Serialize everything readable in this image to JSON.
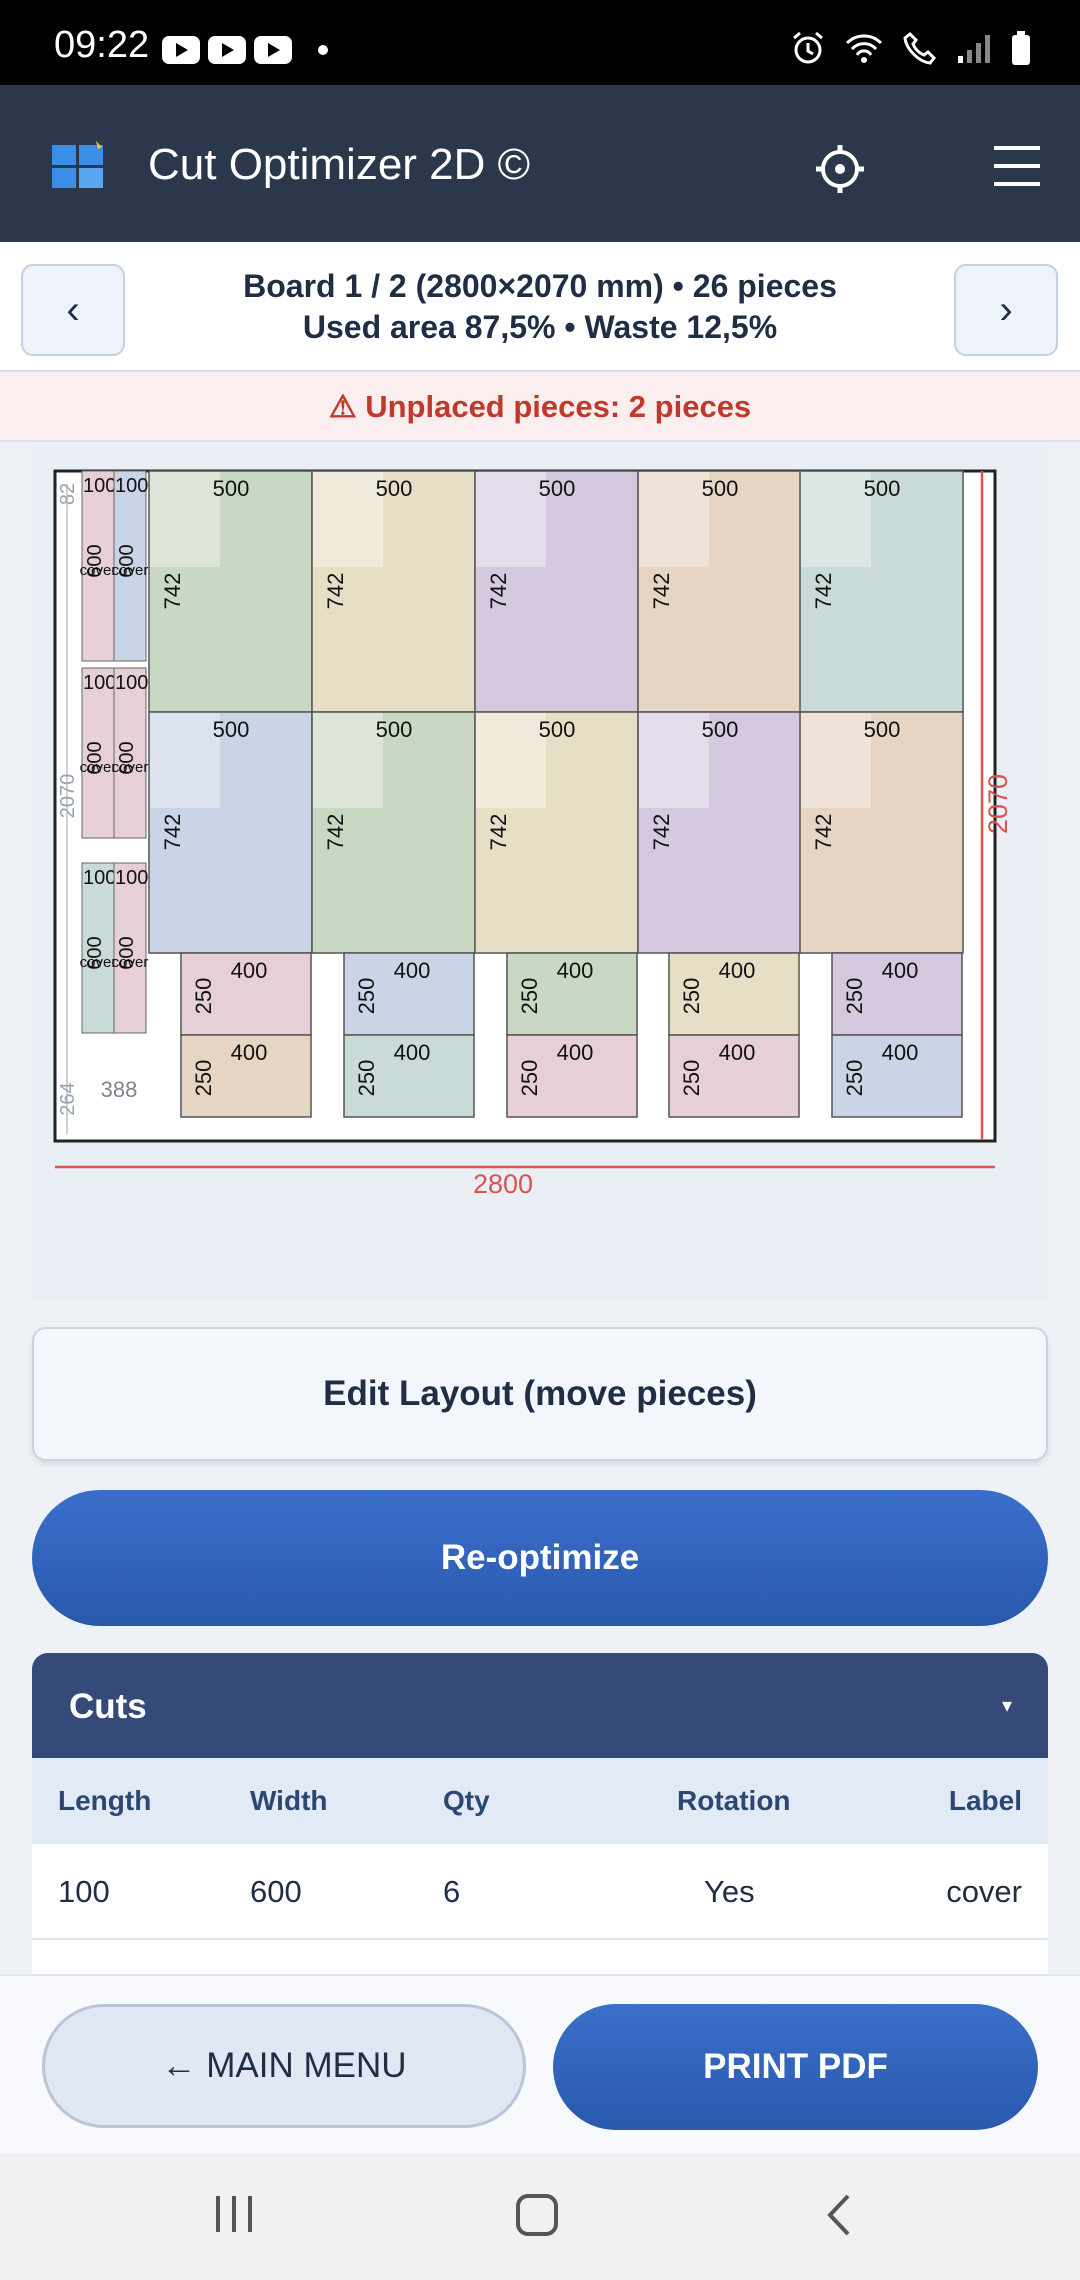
{
  "status_bar": {
    "time": "09:22"
  },
  "app": {
    "title": "Cut Optimizer 2D ©"
  },
  "board": {
    "prev_label": "‹",
    "next_label": "›",
    "line1": "Board 1 / 2 (2800×2070 mm)  •  26 pieces",
    "line2": "Used area 87,5%  •  Waste 12,5%"
  },
  "warning": "⚠ Unplaced pieces: 2 pieces",
  "layout": {
    "board_width": "2800",
    "board_height": "2070",
    "large_width": "500",
    "large_height": "742",
    "small_width": "400",
    "small_height": "250",
    "strip_width": "100",
    "strip_height": "600",
    "strip_label": "cover",
    "top_gap": "82",
    "left_gap": "2070",
    "bottom_gap": "264",
    "waste_width": "388",
    "colors": {
      "green": "#c9d8c3",
      "beige": "#e7dfc5",
      "lavender": "#d4c9df",
      "tan": "#e6d5c3",
      "teal": "#c9dbd8",
      "blue": "#c9d4e6",
      "pink": "#e6cfd6",
      "dim_red": "#d9534f"
    }
  },
  "edit_button": "Edit Layout (move pieces)",
  "reoptimize_button": "Re-optimize",
  "cuts": {
    "title": "Cuts",
    "toggle": "▾",
    "columns": [
      "Length",
      "Width",
      "Qty",
      "Rotation",
      "Label"
    ],
    "rows": [
      [
        "100",
        "600",
        "6",
        "Yes",
        "cover"
      ]
    ]
  },
  "bottom": {
    "main_menu": "← MAIN MENU",
    "print_pdf": "PRINT PDF"
  }
}
